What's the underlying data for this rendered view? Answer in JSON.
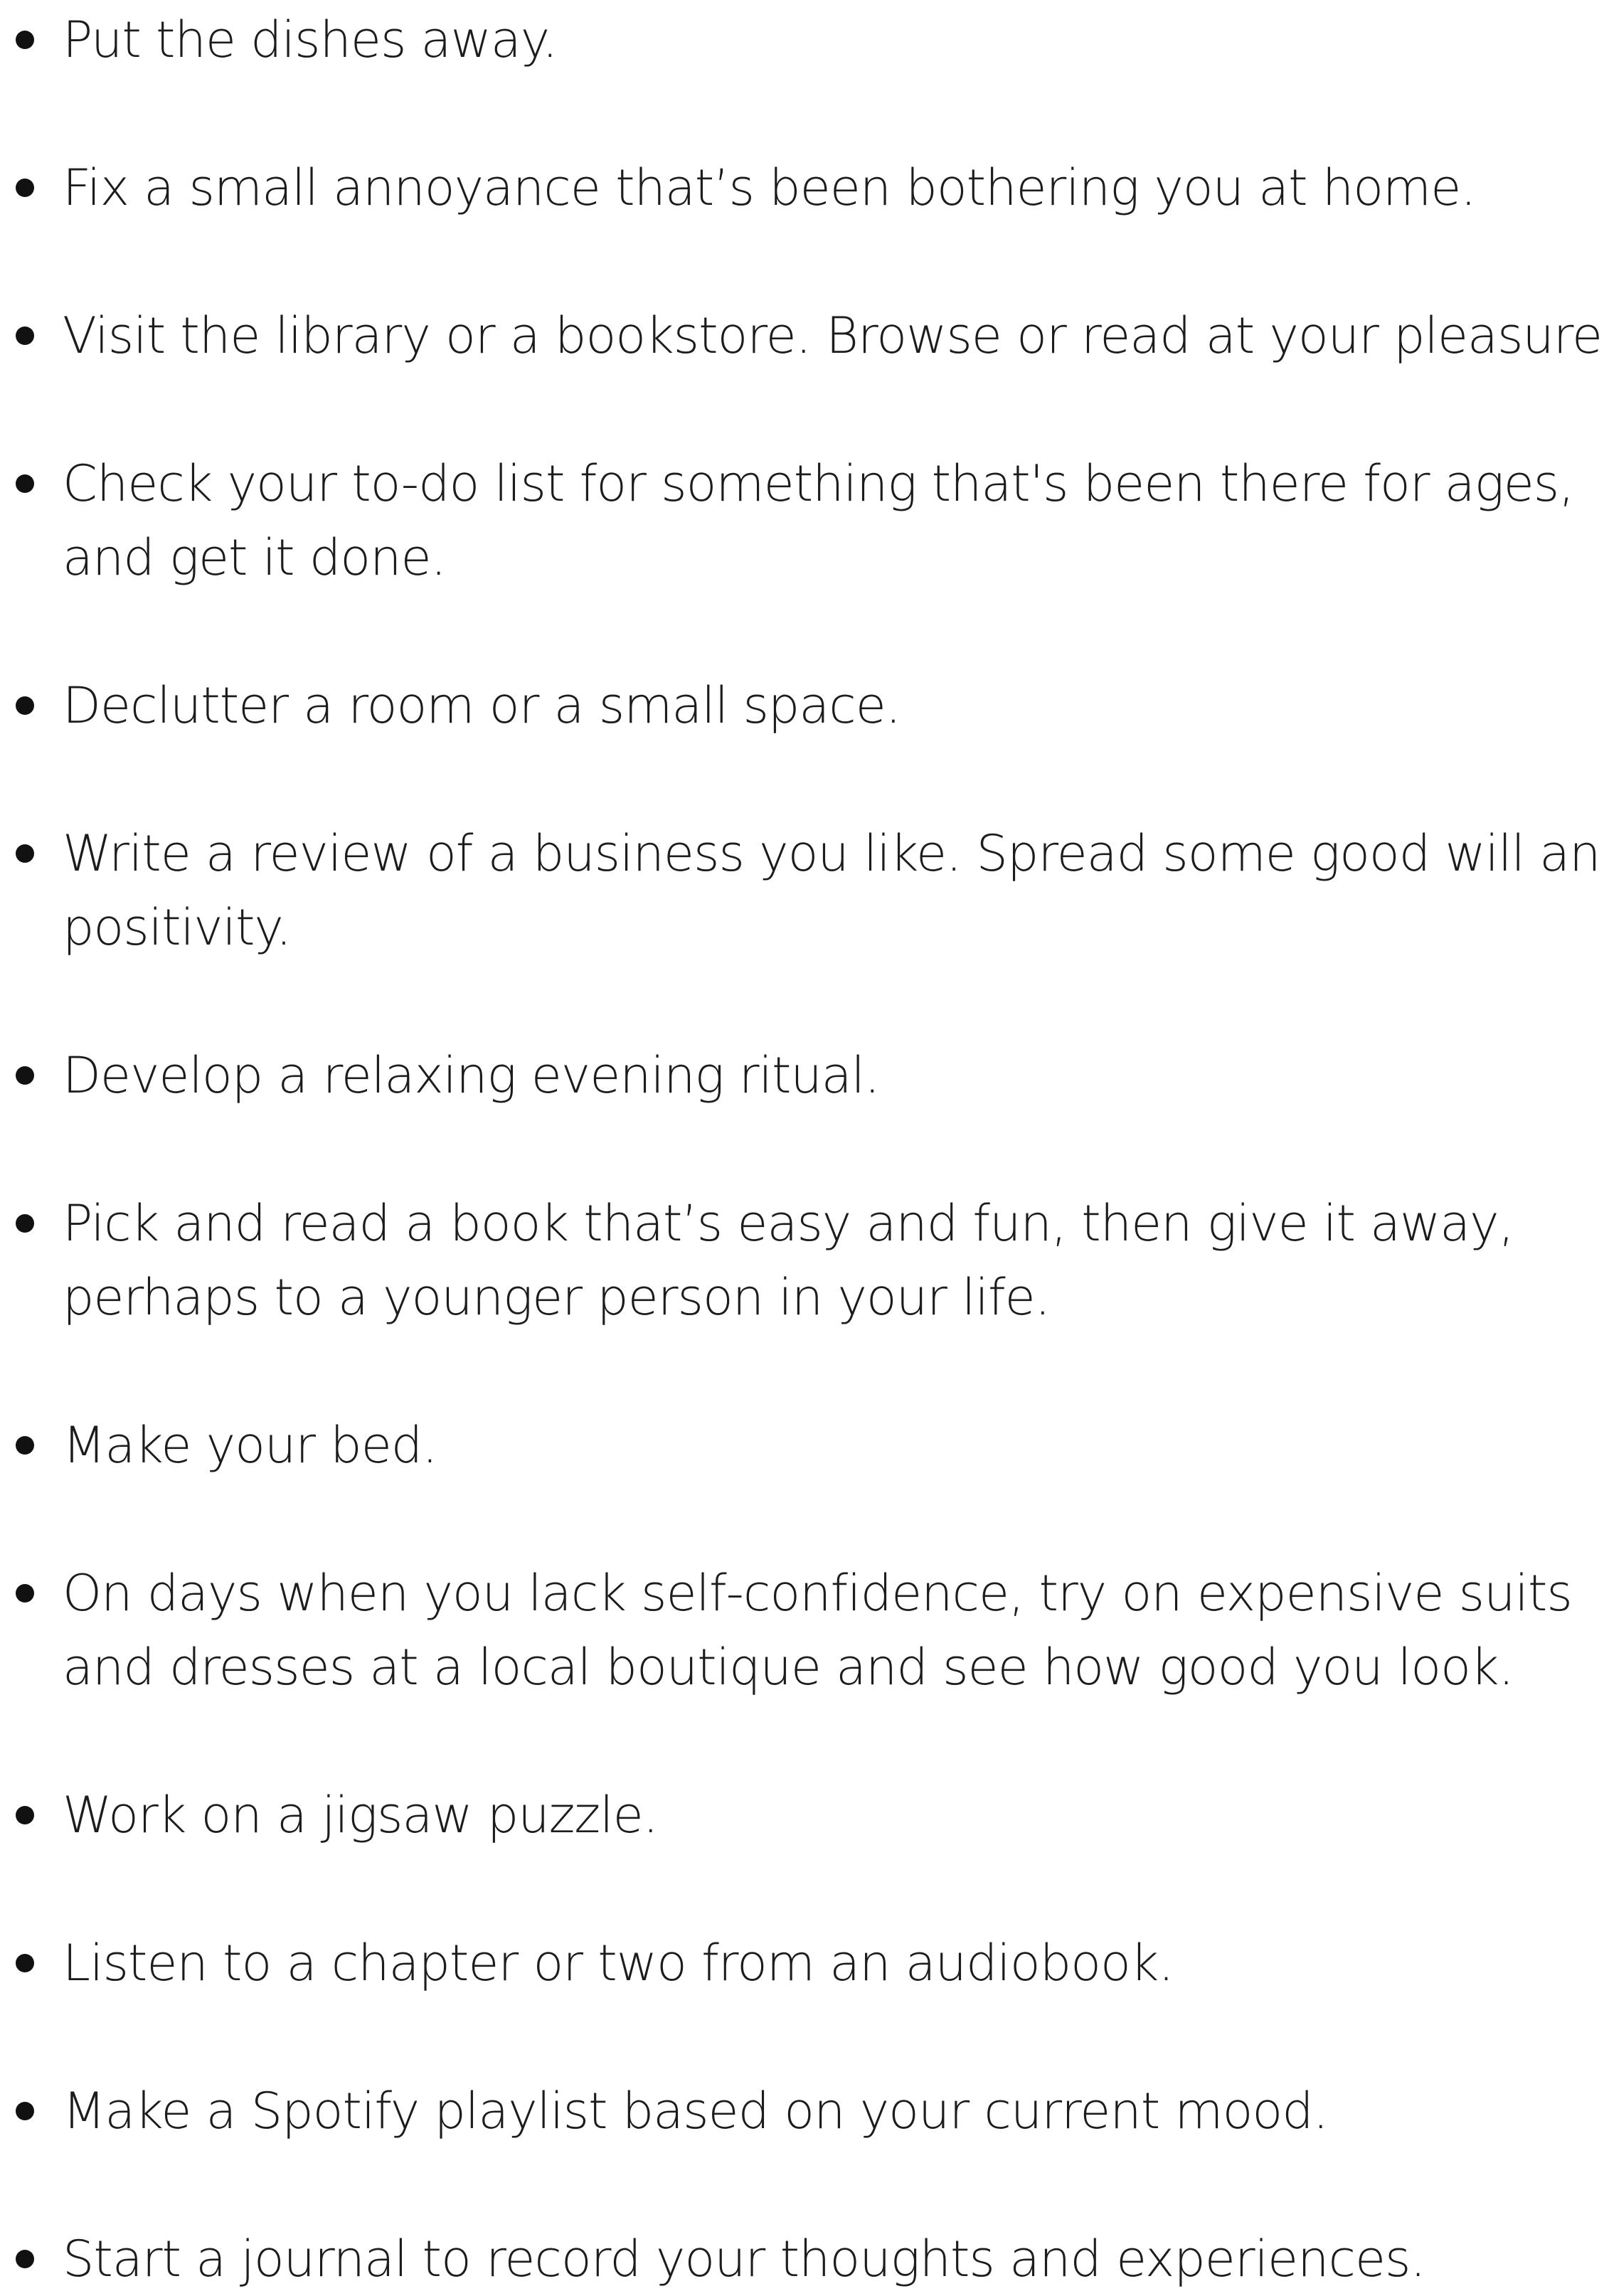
{
  "list": {
    "items": [
      {
        "lines": [
          "Put the dishes away."
        ]
      },
      {
        "lines": [
          "Fix a small annoyance that’s been bothering you at home."
        ]
      },
      {
        "lines": [
          "Visit the library or a bookstore. Browse or read at your pleasure."
        ]
      },
      {
        "lines": [
          "Check your to-do list for something that's been there for ages,",
          "and get it done."
        ]
      },
      {
        "lines": [
          "Declutter a room or a small space."
        ]
      },
      {
        "lines": [
          "Write a review of a business you like. Spread some good will and",
          "positivity."
        ]
      },
      {
        "lines": [
          "Develop a relaxing evening ritual."
        ]
      },
      {
        "lines": [
          "Pick and read a book that’s easy and fun, then give it away,",
          "perhaps to a younger person in your life."
        ]
      },
      {
        "lines": [
          "Make your bed."
        ]
      },
      {
        "lines": [
          "On days when you lack self-confidence, try on expensive suits",
          "and dresses at a local boutique and see how good you look."
        ]
      },
      {
        "lines": [
          "Work on a jigsaw puzzle."
        ]
      },
      {
        "lines": [
          "Listen to a chapter or two from an audiobook."
        ]
      },
      {
        "lines": [
          "Make a Spotify playlist based on your current mood."
        ]
      },
      {
        "lines": [
          "Start a journal to record your thoughts and experiences."
        ]
      }
    ]
  }
}
